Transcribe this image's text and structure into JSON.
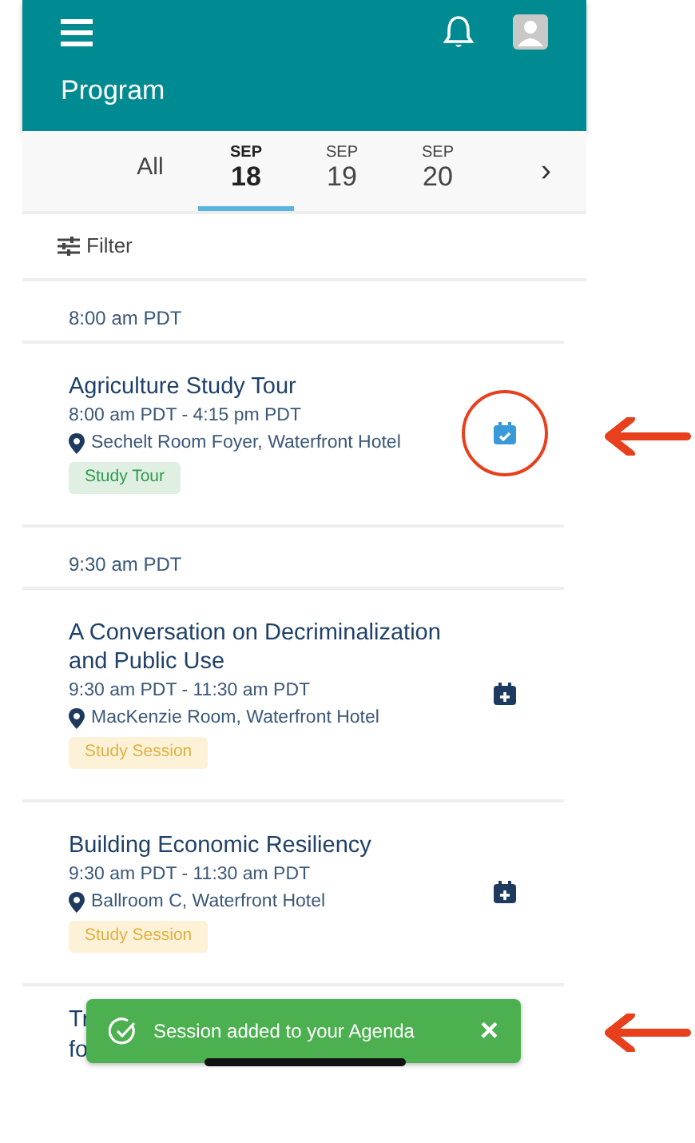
{
  "header": {
    "title": "Program"
  },
  "days": [
    {
      "label": "All",
      "selected": false
    },
    {
      "month": "SEP",
      "day": "18",
      "selected": true
    },
    {
      "month": "SEP",
      "day": "19",
      "selected": false
    },
    {
      "month": "SEP",
      "day": "20",
      "selected": false
    }
  ],
  "next_arrow": "›",
  "filter": {
    "label": "Filter"
  },
  "groups": [
    {
      "time": "8:00 am PDT",
      "sessions": [
        {
          "title": "Agriculture Study Tour",
          "time": "8:00 am PDT - 4:15 pm PDT",
          "location": "Sechelt Room Foyer, Waterfront Hotel",
          "tag": "Study Tour",
          "kind": "tour",
          "added": true,
          "callout": true
        }
      ]
    },
    {
      "time": "9:30 am PDT",
      "sessions": [
        {
          "title": "A Conversation on Decriminalization and Public Use",
          "time": "9:30 am PDT - 11:30 am PDT",
          "location": "MacKenzie Room, Waterfront Hotel",
          "tag": "Study Session",
          "kind": "session",
          "added": false,
          "callout": false
        },
        {
          "title": "Building Economic Resiliency",
          "time": "9:30 am PDT - 11:30 am PDT",
          "location": "Ballroom C, Waterfront Hotel",
          "tag": "Study Session",
          "kind": "session",
          "added": false,
          "callout": false
        }
      ]
    }
  ],
  "partial_title": [
    "Tr",
    "fo"
  ],
  "toast": {
    "message": "Session added to your Agenda",
    "close": "×",
    "callout": true
  }
}
